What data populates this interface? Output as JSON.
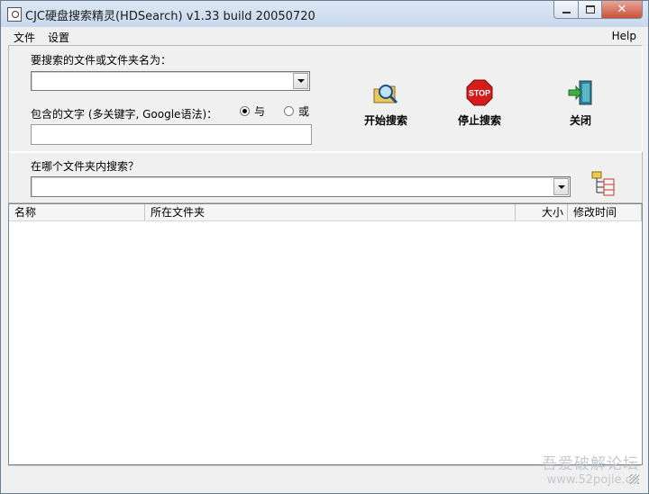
{
  "window": {
    "title": "CJC硬盘搜索精灵(HDSearch) v1.33 build 20050720",
    "close_glyph": "✕"
  },
  "menu": {
    "file": "文件",
    "settings": "设置",
    "help": "Help"
  },
  "search": {
    "name_label": "要搜索的文件或文件夹名为：",
    "name_value": "",
    "text_label": "包含的文字 (多关键字, Google语法)：",
    "text_value": "",
    "radio_and": "与",
    "radio_or": "或",
    "selected_mode": "与",
    "folder_label": "在哪个文件夹内搜索？",
    "folder_value": ""
  },
  "toolbar": {
    "start_label": "开始搜索",
    "stop_label": "停止搜索",
    "stop_sign_text": "STOP",
    "close_label": "关闭",
    "start_icon": "magnifier-folder-icon",
    "stop_icon": "stop-sign-icon",
    "close_icon": "exit-door-icon",
    "browse_icon": "folder-tree-icon"
  },
  "results": {
    "columns": [
      "名称",
      "所在文件夹",
      "大小",
      "修改时间"
    ],
    "rows": []
  },
  "watermark": {
    "line1": "吾爱破解论坛",
    "line2": "www.52pojie.cn"
  }
}
